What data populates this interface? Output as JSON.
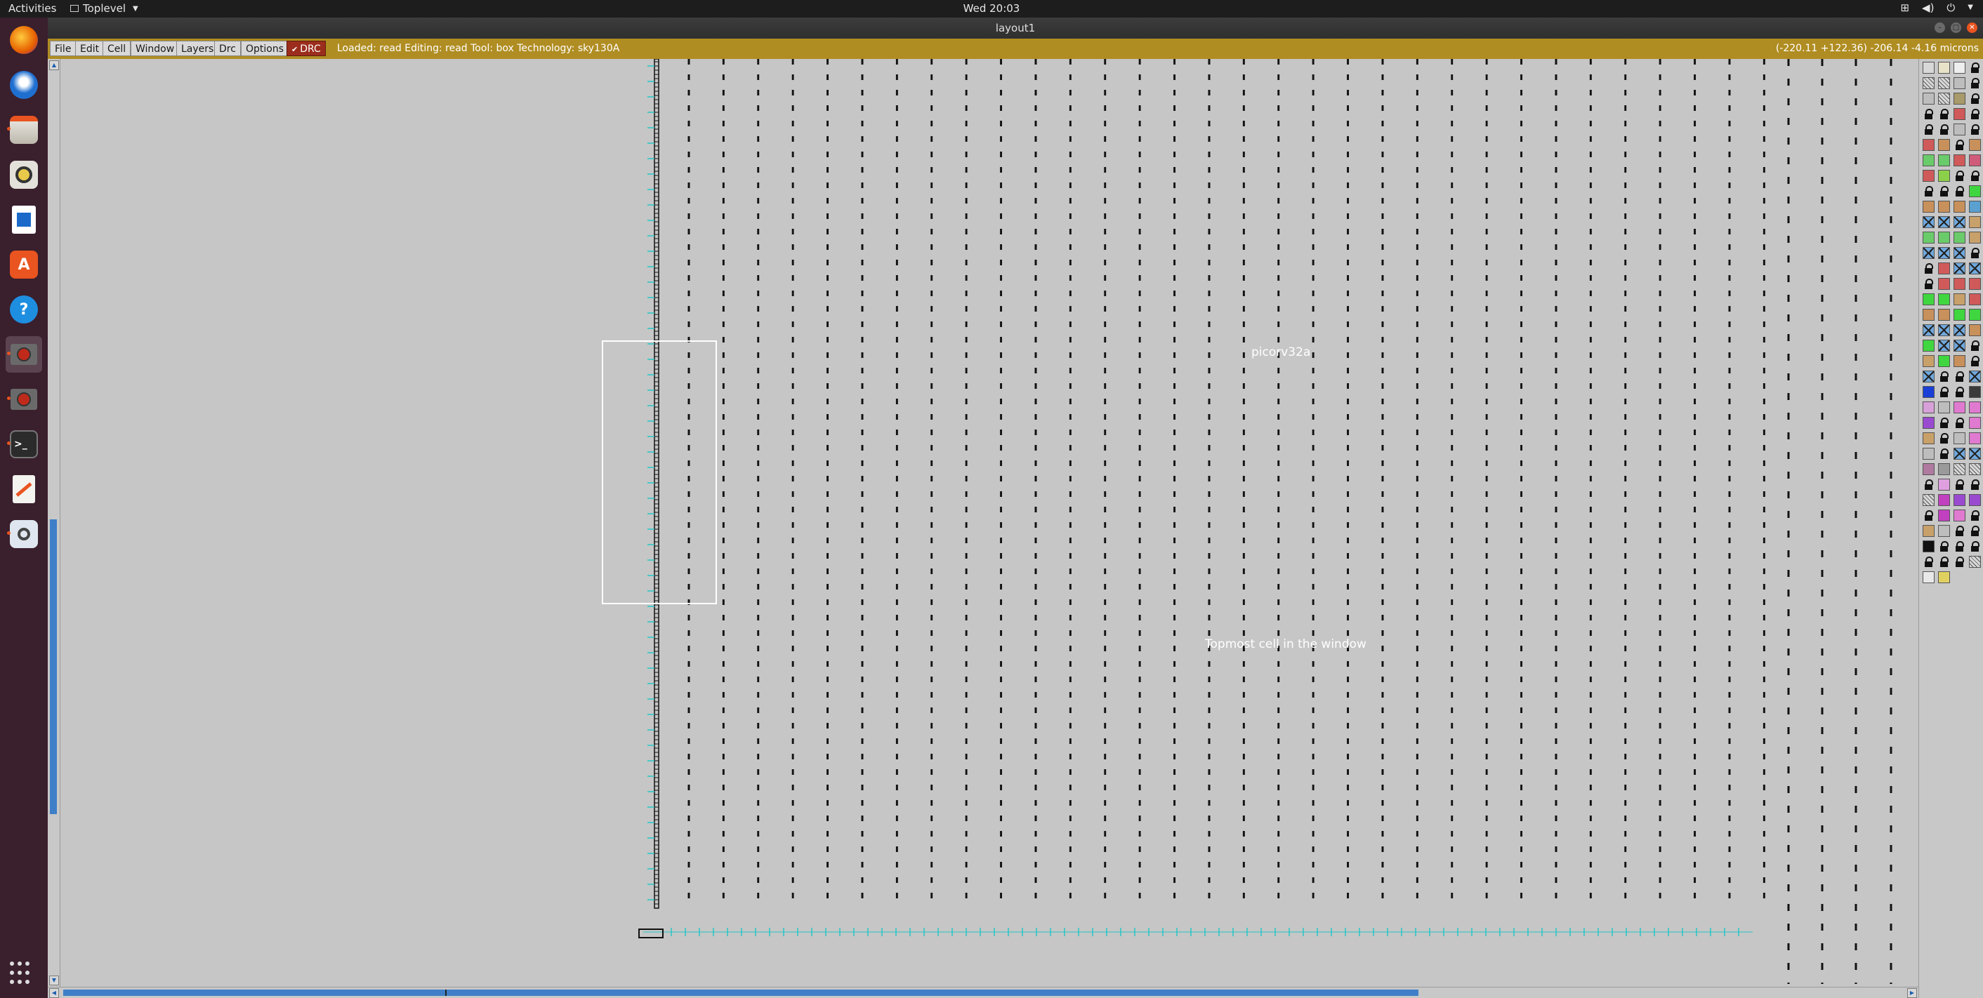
{
  "topbar": {
    "activities": "Activities",
    "app_name": "Toplevel",
    "clock": "Wed 20:03",
    "tray_icons": [
      "network-icon",
      "volume-icon",
      "power-icon",
      "system-menu-arrow"
    ]
  },
  "window": {
    "title": "layout1",
    "buttons": [
      "minimize",
      "maximize",
      "close"
    ]
  },
  "dock": {
    "items": [
      {
        "name": "firefox",
        "color": "#e66000"
      },
      {
        "name": "thunderbird",
        "color": "#1f6fd0"
      },
      {
        "name": "files",
        "color": "#d9d5cc"
      },
      {
        "name": "rhythmbox",
        "color": "#e9c94a"
      },
      {
        "name": "libreoffice-writer",
        "color": "#1b6ac9"
      },
      {
        "name": "app-store",
        "color": "#e95420"
      },
      {
        "name": "help",
        "color": "#1e8ee0"
      },
      {
        "name": "magic-window-1",
        "color": "#9b2d1c"
      },
      {
        "name": "magic-window-2",
        "color": "#9b2d1c"
      },
      {
        "name": "terminal",
        "color": "#2b2b2b"
      },
      {
        "name": "text-editor",
        "color": "#f3f3f0"
      },
      {
        "name": "image-viewer",
        "color": "#6c8fbe"
      }
    ],
    "show_apps": "show-applications"
  },
  "toolbar": {
    "menus": [
      "File",
      "Edit",
      "Cell",
      "Window",
      "Layers",
      "Drc",
      "Options"
    ],
    "drc_label": "DRC",
    "status": "Loaded: read Editing: read Tool: box  Technology: sky130A",
    "coords": "(-220.11 +122.36) -206.14 -4.16 microns"
  },
  "canvas": {
    "cell_name": "picorv32a",
    "cell_caption": "Topmost cell in the window"
  },
  "palette": {
    "rows": [
      [
        "#d8d8d8",
        "#e8e3c8",
        "#eeeeee",
        "lock"
      ],
      [
        "hatch",
        "hatch",
        "#bdbdbd",
        "lock"
      ],
      [
        "#bdbdbd",
        "hatch",
        "#a89a6a",
        "lock"
      ],
      [
        "lock",
        "lock",
        "#d05a5a",
        "lock"
      ],
      [
        "lock",
        "lock",
        "#bdbdbd",
        "lock"
      ],
      [
        "#d05a5a",
        "#c8905a",
        "lock",
        "#c8905a"
      ],
      [
        "#6acb6a",
        "#6acb6a",
        "#d05a5a",
        "#d05a7a"
      ],
      [
        "#d05a5a",
        "#8cd04a",
        "lock",
        "lock"
      ],
      [
        "lock",
        "lock",
        "lock",
        "#3fd63f"
      ],
      [
        "#c8905a",
        "#c8905a",
        "#c8905a",
        "#5aa0d0"
      ],
      [
        "xbox",
        "xbox",
        "xbox",
        "#c8a06a"
      ],
      [
        "#6acb6a",
        "#6acb6a",
        "#6acb6a",
        "#c8a06a"
      ],
      [
        "xbox",
        "xbox",
        "xbox",
        "lock"
      ],
      [
        "lock",
        "#d05a5a",
        "xbox",
        "xbox"
      ],
      [
        "lock",
        "#d05a5a",
        "#d05a5a",
        "#d05a5a"
      ],
      [
        "#3fd63f",
        "#3fd63f",
        "#c8a06a",
        "#d05a5a"
      ],
      [
        "#c8905a",
        "#c8905a",
        "#3fd63f",
        "#3fd63f"
      ],
      [
        "xbox",
        "xbox",
        "xbox",
        "#c8905a"
      ],
      [
        "#3fd63f",
        "xbox",
        "xbox",
        "lock"
      ],
      [
        "#c8a06a",
        "#3fd63f",
        "#c8905a",
        "lock"
      ],
      [
        "xbox",
        "lock",
        "lock",
        "xbox"
      ],
      [
        "#1a3fd6",
        "lock",
        "lock",
        "#3a3a3a"
      ],
      [
        "#d8a0d8",
        "#bdbdbd",
        "#e07ad0",
        "#e07ad0"
      ],
      [
        "#9a4ad0",
        "lock",
        "lock",
        "#e07ad0"
      ],
      [
        "#c8a06a",
        "lock",
        "#bdbdbd",
        "#e07ad0"
      ],
      [
        "#bdbdbd",
        "lock",
        "xbox",
        "xbox"
      ],
      [
        "#b07aa0",
        "#9a9a9a",
        "hatch",
        "hatch"
      ],
      [
        "lock",
        "#e0a0e0",
        "lock",
        "lock"
      ],
      [
        "hatch",
        "#c040c0",
        "#9a4ad0",
        "#9a4ad0"
      ],
      [
        "lock",
        "#c040c0",
        "#e07ad0",
        "lock"
      ],
      [
        "#c8a06a",
        "#bdbdbd",
        "lock",
        "lock"
      ],
      [
        "#111111",
        "lock",
        "lock",
        "lock"
      ],
      [
        "lock",
        "lock",
        "lock",
        "hatch"
      ],
      [
        "#e8e8e8",
        "#e0d060"
      ]
    ]
  }
}
